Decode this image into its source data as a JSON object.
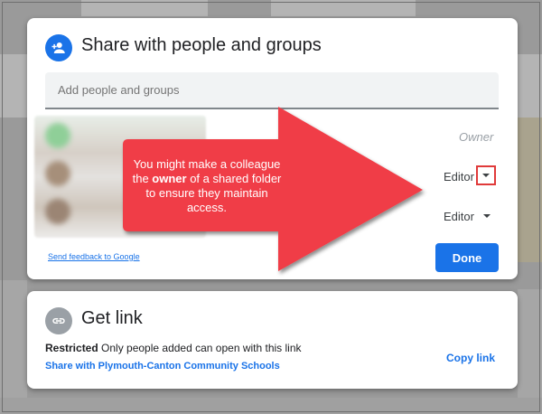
{
  "share_dialog": {
    "title": "Share with people and groups",
    "add_placeholder": "Add people and groups",
    "owner_label": "Owner",
    "people": [
      {
        "role": "Editor"
      },
      {
        "role": "Editor"
      }
    ],
    "feedback_link": "Send feedback to Google",
    "done_label": "Done"
  },
  "annotation": {
    "line1": "You might make a colleague",
    "line2_pre": "the ",
    "line2_bold": "owner",
    "line2_post": " of a shared folder",
    "line3": "to ensure they maintain",
    "line4": "access."
  },
  "link_dialog": {
    "title": "Get link",
    "restricted_label": "Restricted",
    "restricted_desc": "Only people added can open with this link",
    "share_with": "Share with Plymouth-Canton Community Schools",
    "copy_link": "Copy link"
  },
  "colors": {
    "accent": "#1a73e8",
    "arrow": "#f03c46",
    "highlight": "#e03a3a"
  },
  "icons": {
    "add_person": "person-add-icon",
    "link": "link-icon",
    "dropdown": "chevron-down-icon"
  }
}
